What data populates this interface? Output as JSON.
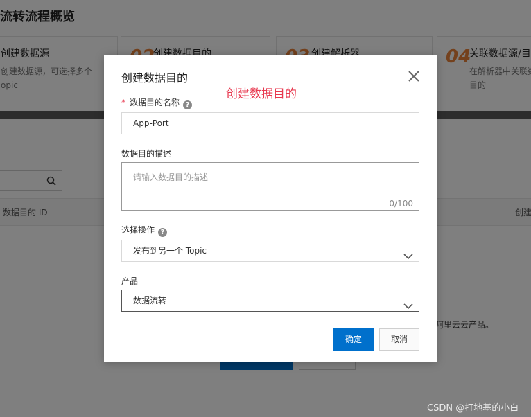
{
  "page": {
    "title": "流转流程概览",
    "steps": [
      {
        "num": "",
        "title": "创建数据源",
        "desc": [
          "创建数据源，可选择多个",
          "opic"
        ]
      },
      {
        "num": "02",
        "title": "创建数据目的",
        "desc": []
      },
      {
        "num": "03",
        "title": "创建解析器",
        "desc": []
      },
      {
        "num": "04",
        "title": "关联数据源/目",
        "desc": [
          "在解析器中关联数",
          "目的"
        ]
      }
    ],
    "table_header_left": "数据目的 ID",
    "table_header_right": "创建",
    "empty_text": "阿里云云产品。"
  },
  "modal": {
    "title": "创建数据目的",
    "annotation": "创建数据目的",
    "name_label": "数据目的名称",
    "required_mark": "*",
    "name_value": "App-Port",
    "desc_label": "数据目的描述",
    "desc_placeholder": "请输入数据目的描述",
    "desc_count": "0/100",
    "operation_label": "选择操作",
    "operation_value": "发布到另一个 Topic",
    "product_label": "产品",
    "product_value": "数据流转",
    "ok_label": "确定",
    "cancel_label": "取消"
  },
  "watermark": "CSDN @打地基的小白",
  "colors": {
    "primary": "#0070cc",
    "accent": "#e8833a",
    "annotation": "#e8384f"
  }
}
